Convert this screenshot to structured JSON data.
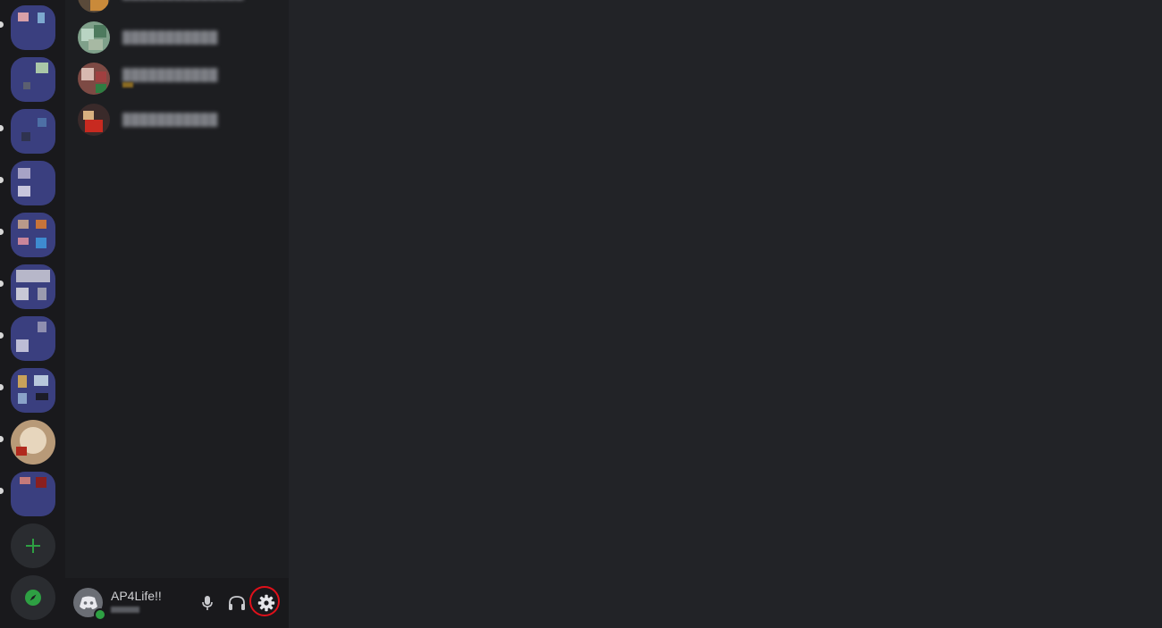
{
  "user": {
    "display_name": "AP4Life!!",
    "status": "online"
  },
  "rail": {
    "servers": [
      {
        "icon": "server-icon-1",
        "unread": true
      },
      {
        "icon": "server-icon-2",
        "unread": false
      },
      {
        "icon": "server-icon-3",
        "unread": true
      },
      {
        "icon": "server-icon-4",
        "unread": true
      },
      {
        "icon": "server-icon-5",
        "unread": true
      },
      {
        "icon": "server-icon-6",
        "unread": true
      },
      {
        "icon": "server-icon-7",
        "unread": true
      },
      {
        "icon": "server-icon-8",
        "unread": true
      },
      {
        "icon": "server-icon-9",
        "unread": true
      },
      {
        "icon": "server-icon-10",
        "unread": true
      }
    ],
    "add_server_icon": "plus-icon",
    "explore_icon": "compass-icon"
  },
  "controls": {
    "mic_icon": "microphone-icon",
    "headphones_icon": "headphones-icon",
    "settings_icon": "gear-icon",
    "highlight_color": "#e0101a"
  },
  "colors": {
    "rail_bg": "#19191c",
    "channels_bg": "#1d1e21",
    "main_bg": "#222327",
    "accent_green": "#2ea043"
  }
}
